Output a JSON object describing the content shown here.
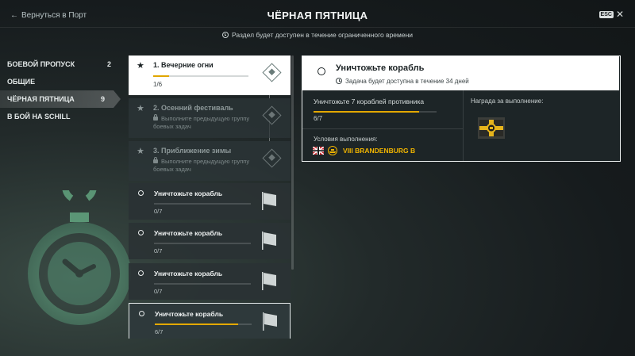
{
  "header": {
    "back_label": "Вернуться в Порт",
    "title": "ЧЁРНАЯ ПЯТНИЦА",
    "esc_label": "ESC",
    "notice": "Раздел будет доступен в течение ограниченного времени"
  },
  "sidebar": {
    "items": [
      {
        "label": "БОЕВОЙ ПРОПУСК",
        "count": "2"
      },
      {
        "label": "ОБЩИЕ",
        "count": ""
      },
      {
        "label": "ЧЁРНАЯ ПЯТНИЦА",
        "count": "9"
      },
      {
        "label": "В БОЙ НА SCHILL",
        "count": ""
      }
    ]
  },
  "groups": [
    {
      "title": "1. Вечерние огни",
      "progress_text": "1/6",
      "progress": 0.17
    },
    {
      "title": "2. Осенний фестиваль",
      "locked_text": "Выполните предыдущую группу боевых задач"
    },
    {
      "title": "3. Приближение зимы",
      "locked_text": "Выполните предыдущую группу боевых задач"
    }
  ],
  "missions": [
    {
      "title": "Уничтожьте корабль",
      "progress_text": "0/7",
      "progress": 0
    },
    {
      "title": "Уничтожьте корабль",
      "progress_text": "0/7",
      "progress": 0
    },
    {
      "title": "Уничтожьте корабль",
      "progress_text": "0/7",
      "progress": 0
    },
    {
      "title": "Уничтожьте корабль",
      "progress_text": "6/7",
      "progress": 0.857
    }
  ],
  "detail": {
    "title": "Уничтожьте корабль",
    "subtitle": "Задача будет доступна в течение 34 дней",
    "objective": "Уничтожьте 7 кораблей противника",
    "progress_text": "6/7",
    "progress": 0.857,
    "conditions_label": "Условия выполнения:",
    "ship_name": "VIII BRANDENBURG B",
    "reward_label": "Награда за выполнение:"
  },
  "colors": {
    "accent": "#e3a800",
    "ship_name": "#f0b400",
    "glow": "#7fe0a8"
  },
  "icons": [
    "arrow-left-icon",
    "clock-icon",
    "star-icon",
    "lock-icon",
    "diamond-icon",
    "flag-icon",
    "stopwatch-icon",
    "nation-flag-icon",
    "ship-tier-icon",
    "reward-flag-icon"
  ]
}
